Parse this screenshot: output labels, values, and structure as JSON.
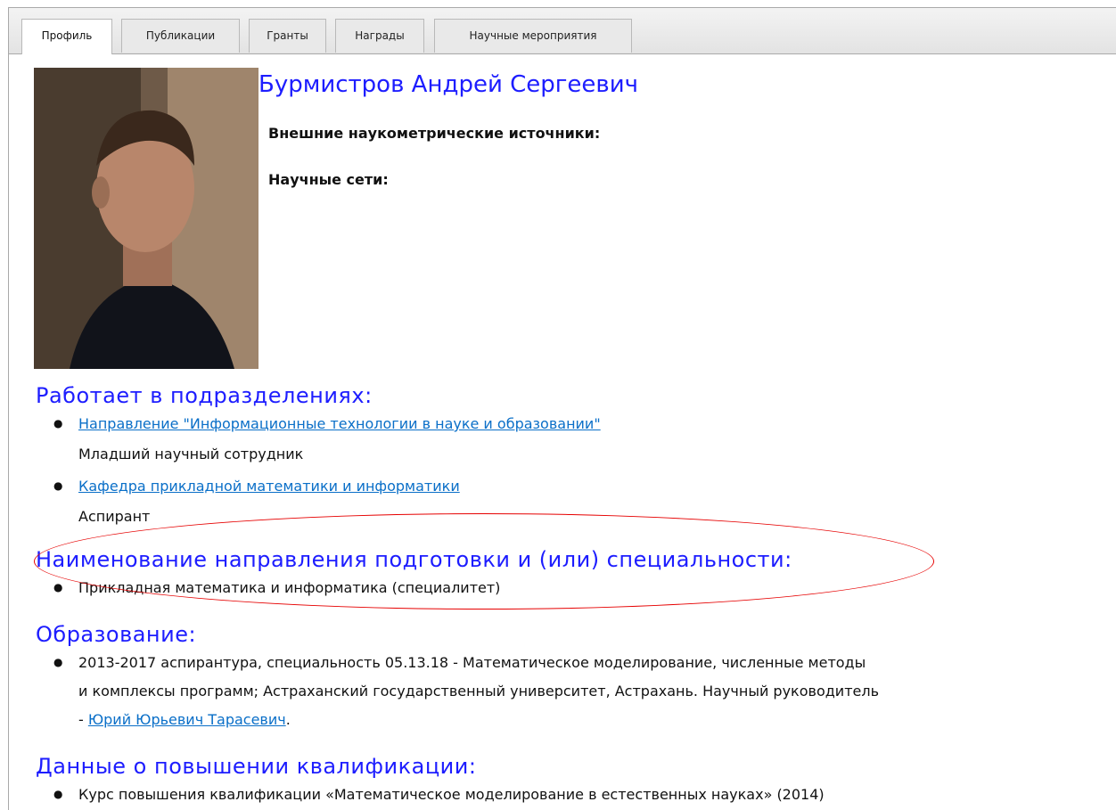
{
  "tabs": [
    "Профиль",
    "Публикации",
    "Гранты",
    "Награды",
    "Научные мероприятия"
  ],
  "profile": {
    "name": "Бурмистров Андрей Сергеевич",
    "scientometric_label": "Внешние наукометрические источники:",
    "networks_label": "Научные сети:"
  },
  "departments": {
    "title": "Работает в подразделениях:",
    "items": [
      {
        "link": "Направление \"Информационные технологии в науке и образовании\"",
        "role": "Младший научный сотрудник"
      },
      {
        "link": "Кафедра прикладной математики и информатики",
        "role": "Аспирант"
      }
    ]
  },
  "specialty": {
    "title": "Наименование направления подготовки и (или) специальности:",
    "item": "Прикладная математика и информатика (специалитет)"
  },
  "education": {
    "title": "Образование:",
    "line1": "2013-2017 аспирантура, специальность 05.13.18 - Математическое моделирование, численные методы",
    "line2": "и комплексы программ; Астраханский государственный университет, Астрахань. Научный руководитель",
    "line3_prefix": "- ",
    "supervisor_link": "Юрий Юрьевич Тарасевич",
    "line3_suffix": "."
  },
  "qualification": {
    "title": "Данные о повышении квалификации:",
    "item": "Курс повышения квалификации «Математическое моделирование в естественных науках» (2014)"
  },
  "colors": {
    "heading": "#1d1dff",
    "link": "#0a6fc8",
    "highlight_ellipse": "#e60000"
  }
}
